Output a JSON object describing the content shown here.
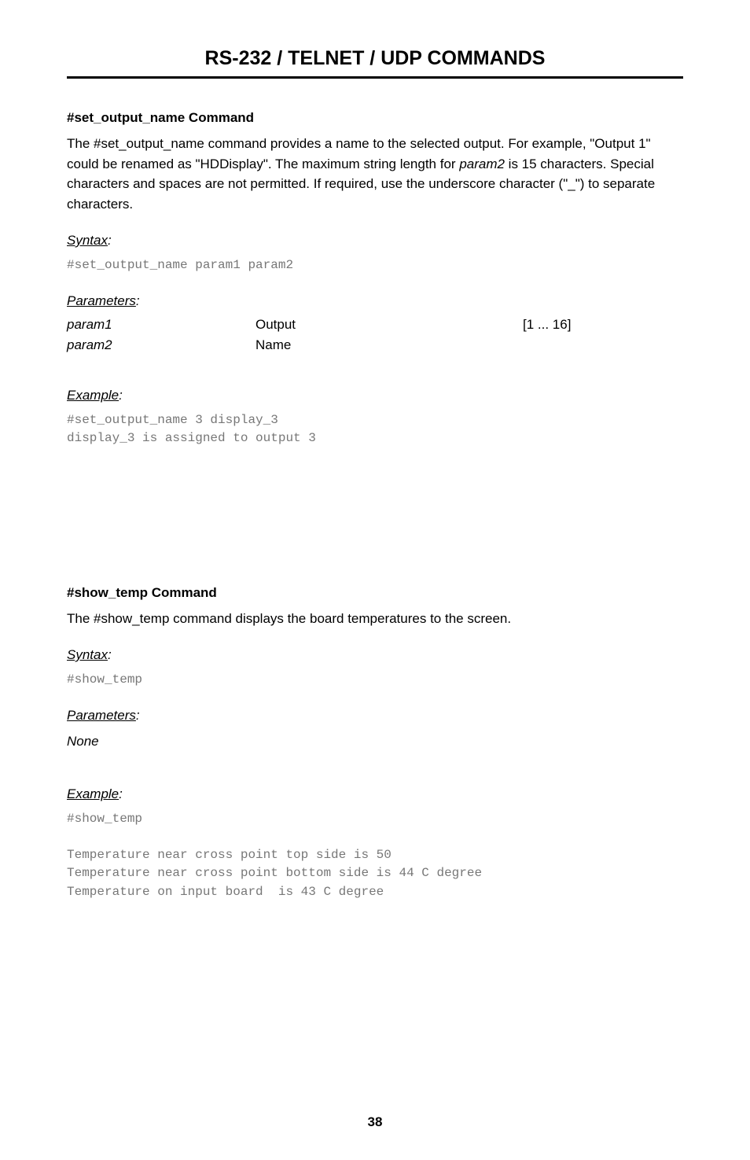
{
  "page_title": "RS-232 / TELNET / UDP COMMANDS",
  "section1": {
    "heading": "#set_output_name Command",
    "body_pre": "The #set_output_name command provides a name to the selected output.  For example, \"Output 1\" could be renamed as \"HDDisplay\".  The maximum string length for ",
    "body_param_italic": "param2",
    "body_post": " is 15 characters.  Special characters and spaces are not permitted.  If required, use the underscore character (\"_\") to separate characters.",
    "syntax_label_ul": "Syntax",
    "syntax_label_colon": ":",
    "syntax_code": "#set_output_name param1 param2",
    "params_label_ul": "Parameters",
    "params_label_colon": ":",
    "params": [
      {
        "name": "param1",
        "desc": "Output",
        "range": "[1 ... 16]"
      },
      {
        "name": "param2",
        "desc": "Name",
        "range": ""
      }
    ],
    "example_label_ul": "Example",
    "example_label_colon": ":",
    "example_code": "#set_output_name 3 display_3\ndisplay_3 is assigned to output 3"
  },
  "section2": {
    "heading": "#show_temp Command",
    "body": "The #show_temp command displays the board temperatures to the screen.",
    "syntax_label_ul": "Syntax",
    "syntax_label_colon": ":",
    "syntax_code": "#show_temp",
    "params_label_ul": "Parameters",
    "params_label_colon": ":",
    "params_none": "None",
    "example_label_ul": "Example",
    "example_label_colon": ":",
    "example_code": "#show_temp\n\nTemperature near cross point top side is 50\nTemperature near cross point bottom side is 44 C degree\nTemperature on input board  is 43 C degree"
  },
  "page_number": "38"
}
